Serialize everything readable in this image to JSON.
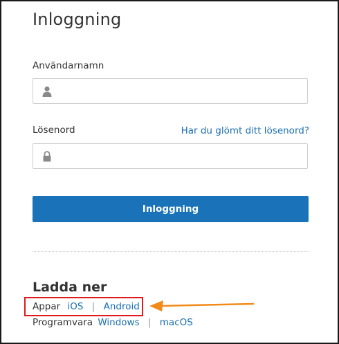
{
  "login": {
    "title": "Inloggning",
    "username_label": "Användarnamn",
    "username_value": "",
    "username_placeholder": "",
    "password_label": "Lösenord",
    "password_value": "",
    "password_placeholder": "",
    "forgot_link": "Har du glömt ditt lösenord?",
    "submit_label": "Inloggning"
  },
  "downloads": {
    "title": "Ladda ner",
    "apps_label": "Appar",
    "apps": [
      "iOS",
      "Android"
    ],
    "software_label": "Programvara",
    "software": [
      "Windows",
      "macOS"
    ],
    "separator": "|"
  },
  "icons": {
    "username": "user-icon",
    "password": "lock-icon"
  },
  "colors": {
    "accent": "#1a73b8",
    "link": "#1a6fb0",
    "highlight_box": "#e01a1a",
    "annotation_arrow": "#f28a1a"
  }
}
